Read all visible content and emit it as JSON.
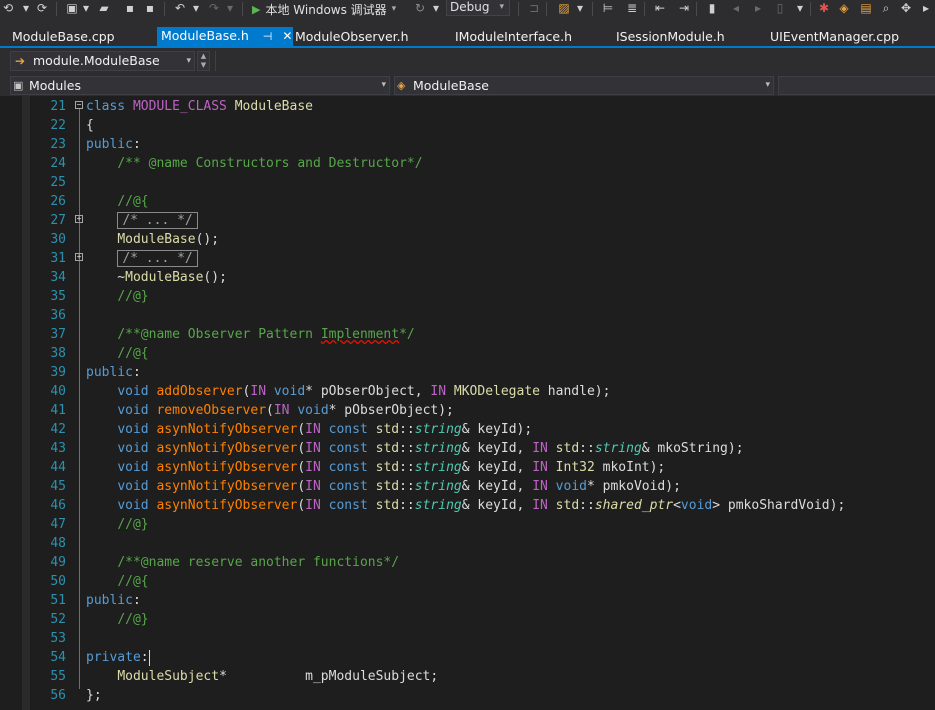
{
  "toolbar": {
    "debug_target": "本地 Windows 调试器",
    "configuration": "Debug"
  },
  "tabs": [
    {
      "label": "ModuleBase.cpp",
      "active": false
    },
    {
      "label": "ModuleBase.h",
      "active": true
    },
    {
      "label": "ModuleObserver.h",
      "active": false
    },
    {
      "label": "IModuleInterface.h",
      "active": false
    },
    {
      "label": "ISessionModule.h",
      "active": false
    },
    {
      "label": "UIEventManager.cpp",
      "active": false
    }
  ],
  "navigation": {
    "scope": "module.ModuleBase",
    "project": "Modules",
    "class": "ModuleBase"
  },
  "editor": {
    "lines": [
      {
        "n": "21",
        "text": "class MODULE_CLASS ModuleBase"
      },
      {
        "n": "22",
        "text": "{"
      },
      {
        "n": "23",
        "text": "public:"
      },
      {
        "n": "24",
        "text": "    /** @name Constructors and Destructor*/"
      },
      {
        "n": "25",
        "text": ""
      },
      {
        "n": "26",
        "text": "    //@{"
      },
      {
        "n": "27",
        "text": "    /* ... */"
      },
      {
        "n": "30",
        "text": "    ModuleBase();"
      },
      {
        "n": "31",
        "text": "    /* ... */"
      },
      {
        "n": "34",
        "text": "    ~ModuleBase();"
      },
      {
        "n": "35",
        "text": "    //@}"
      },
      {
        "n": "36",
        "text": ""
      },
      {
        "n": "37",
        "text": "    /**@name Observer Pattern Implenment*/"
      },
      {
        "n": "38",
        "text": "    //@{"
      },
      {
        "n": "39",
        "text": "public:"
      },
      {
        "n": "40",
        "text": "    void addObserver(IN void* pObserObject, IN MKODelegate handle);"
      },
      {
        "n": "41",
        "text": "    void removeObserver(IN void* pObserObject);"
      },
      {
        "n": "42",
        "text": "    void asynNotifyObserver(IN const std::string& keyId);"
      },
      {
        "n": "43",
        "text": "    void asynNotifyObserver(IN const std::string& keyId, IN std::string& mkoString);"
      },
      {
        "n": "44",
        "text": "    void asynNotifyObserver(IN const std::string& keyId, IN Int32 mkoInt);"
      },
      {
        "n": "45",
        "text": "    void asynNotifyObserver(IN const std::string& keyId, IN void* pmkoVoid);"
      },
      {
        "n": "46",
        "text": "    void asynNotifyObserver(IN const std::string& keyId, IN std::shared_ptr<void> pmkoShardVoid);"
      },
      {
        "n": "47",
        "text": "    //@}"
      },
      {
        "n": "48",
        "text": ""
      },
      {
        "n": "49",
        "text": "    /**@name reserve another functions*/"
      },
      {
        "n": "50",
        "text": "    //@{"
      },
      {
        "n": "51",
        "text": "public:"
      },
      {
        "n": "52",
        "text": "    //@}"
      },
      {
        "n": "53",
        "text": ""
      },
      {
        "n": "54",
        "text": "private:"
      },
      {
        "n": "55",
        "text": "    ModuleSubject*          m_pModuleSubject;"
      },
      {
        "n": "56",
        "text": "};"
      }
    ]
  }
}
